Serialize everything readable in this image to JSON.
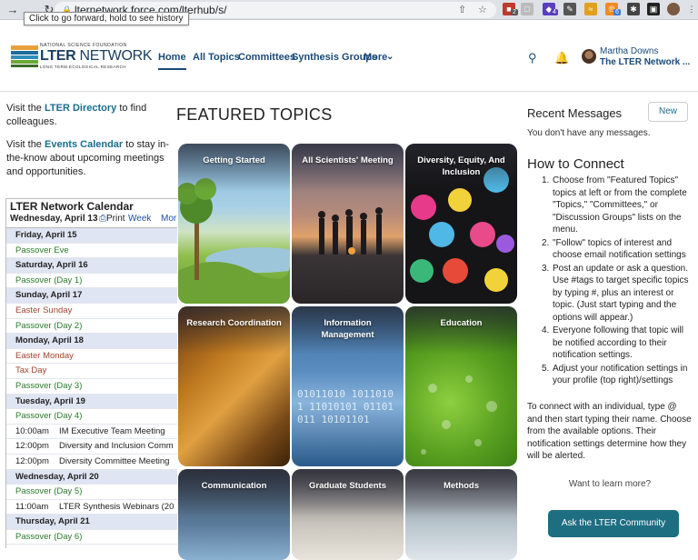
{
  "browser": {
    "url": "lternetwork.force.com/lterhub/s/",
    "tooltip": "Click to go forward, hold to see history",
    "ext_badges": [
      "2",
      "4",
      "6"
    ]
  },
  "header": {
    "logo_top": "NATIONAL SCIENCE FOUNDATION",
    "logo_name_bold": "LTER",
    "logo_name_rest": " NETWORK",
    "logo_sub": "LONG TERM ECOLOGICAL RESEARCH",
    "nav": [
      "Home",
      "All Topics",
      "Committees",
      "Synthesis Groups",
      "More"
    ],
    "user_name": "Martha Downs",
    "user_org": "The LTER Network ..."
  },
  "left": {
    "p1_pre": "Visit the ",
    "p1_link": "LTER Directory",
    "p1_post": " to find colleagues.",
    "p2_pre": "Visit the ",
    "p2_link": "Events Calendar",
    "p2_post": " to stay in-the-know about upcoming meetings and opportunities."
  },
  "calendar": {
    "title": "LTER Network Calendar",
    "date": "Wednesday, April 13",
    "print": "Print",
    "week": "Week",
    "month": "Mor",
    "rows": [
      {
        "type": "day",
        "text": "Friday, April 15"
      },
      {
        "type": "green",
        "text": "Passover Eve"
      },
      {
        "type": "day",
        "text": "Saturday, April 16"
      },
      {
        "type": "green",
        "text": "Passover (Day 1)"
      },
      {
        "type": "day",
        "text": "Sunday, April 17"
      },
      {
        "type": "red",
        "text": "Easter Sunday"
      },
      {
        "type": "green",
        "text": "Passover (Day 2)"
      },
      {
        "type": "day",
        "text": "Monday, April 18"
      },
      {
        "type": "red",
        "text": "Easter Monday"
      },
      {
        "type": "red",
        "text": "Tax Day"
      },
      {
        "type": "green",
        "text": "Passover (Day 3)"
      },
      {
        "type": "day",
        "text": "Tuesday, April 19"
      },
      {
        "type": "green",
        "text": "Passover (Day 4)"
      },
      {
        "type": "event",
        "time": "10:00am",
        "text": "IM Executive Team Meeting"
      },
      {
        "type": "event",
        "time": "12:00pm",
        "text": "Diversity and Inclusion Comm"
      },
      {
        "type": "event",
        "time": "12:00pm",
        "text": "Diversity Committee Meeting"
      },
      {
        "type": "day",
        "text": "Wednesday, April 20"
      },
      {
        "type": "green",
        "text": "Passover (Day 5)"
      },
      {
        "type": "event",
        "time": "11:00am",
        "text": "LTER Synthesis Webinars (20"
      },
      {
        "type": "day",
        "text": "Thursday, April 21"
      },
      {
        "type": "green",
        "text": "Passover (Day 6)"
      }
    ]
  },
  "featured": {
    "title": "FEATURED TOPICS",
    "tiles": [
      {
        "label": "Getting Started"
      },
      {
        "label": "All Scientists' Meeting"
      },
      {
        "label": "Diversity, Equity, And Inclusion"
      },
      {
        "label": "Research Coordination"
      },
      {
        "label": "Information Management"
      },
      {
        "label": "Education"
      },
      {
        "label": "Communication"
      },
      {
        "label": "Graduate Students"
      },
      {
        "label": "Methods"
      }
    ]
  },
  "right": {
    "recent_title": "Recent Messages",
    "new_label": "New",
    "no_messages": "You don't have any messages.",
    "connect_title": "How to Connect",
    "steps": [
      "Choose from \"Featured Topics\" topics at left or from the complete \"Topics,\" \"Committees,\" or \"Discussion Groups\" lists on the menu.",
      "\"Follow\" topics of interest and choose email notification settings",
      "Post an update or ask a question. Use #tags to target specific topics by typing #, plus an interest or topic. (Just start typing and the options will appear.)",
      "Everyone following that topic will be notified according to their notification settings.",
      "Adjust your notification settings in your profile (top right)/settings"
    ],
    "connect_para": "To connect with an individual, type @ and then start typing their name. Choose from the available options. Their notification settings determine how they will be alerted.",
    "learn_more": "Want to learn more?",
    "ask_label": "Ask the LTER Community"
  }
}
